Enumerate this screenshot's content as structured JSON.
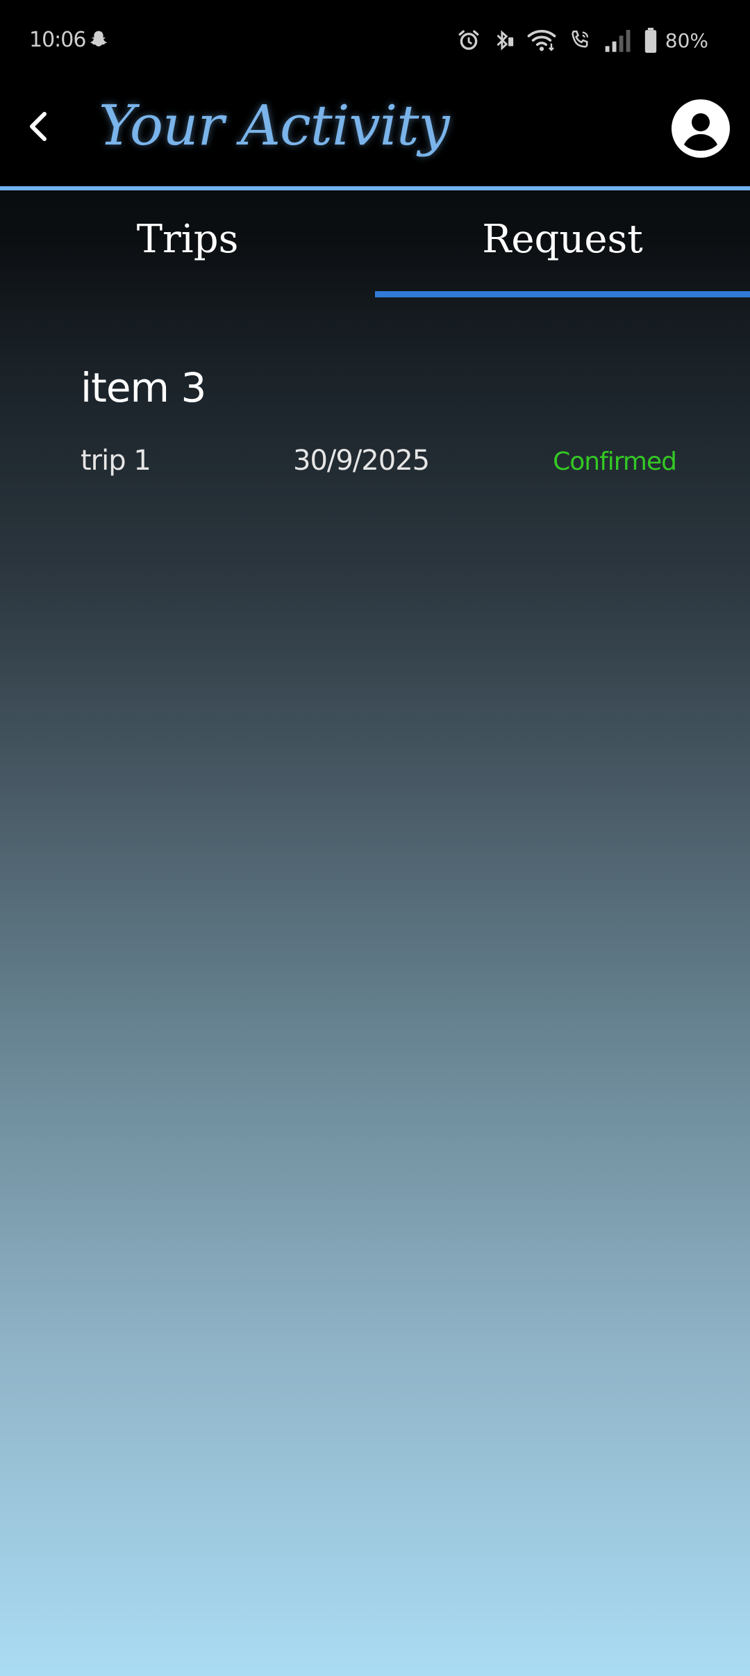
{
  "status_bar": {
    "time": "10:06",
    "battery": "80%",
    "icons": [
      "snapchat-icon",
      "alarm-icon",
      "bluetooth-icon",
      "wifi-icon",
      "wifi-call-icon",
      "signal-icon",
      "battery-icon"
    ]
  },
  "header": {
    "title": "Your Activity",
    "back_icon": "chevron-left-icon",
    "profile_icon": "account-circle-icon",
    "title_color": "#7ab4ea",
    "divider_color": "#6fb2ec"
  },
  "tabs": [
    {
      "label": "Trips",
      "selected": false
    },
    {
      "label": "Request",
      "selected": true
    }
  ],
  "tab_indicator_color": "#2f7ad6",
  "requests": [
    {
      "title": "item 3",
      "trip": "trip 1",
      "date": "30/9/2025",
      "status": "Confirmed",
      "status_color": "#34c924"
    }
  ]
}
